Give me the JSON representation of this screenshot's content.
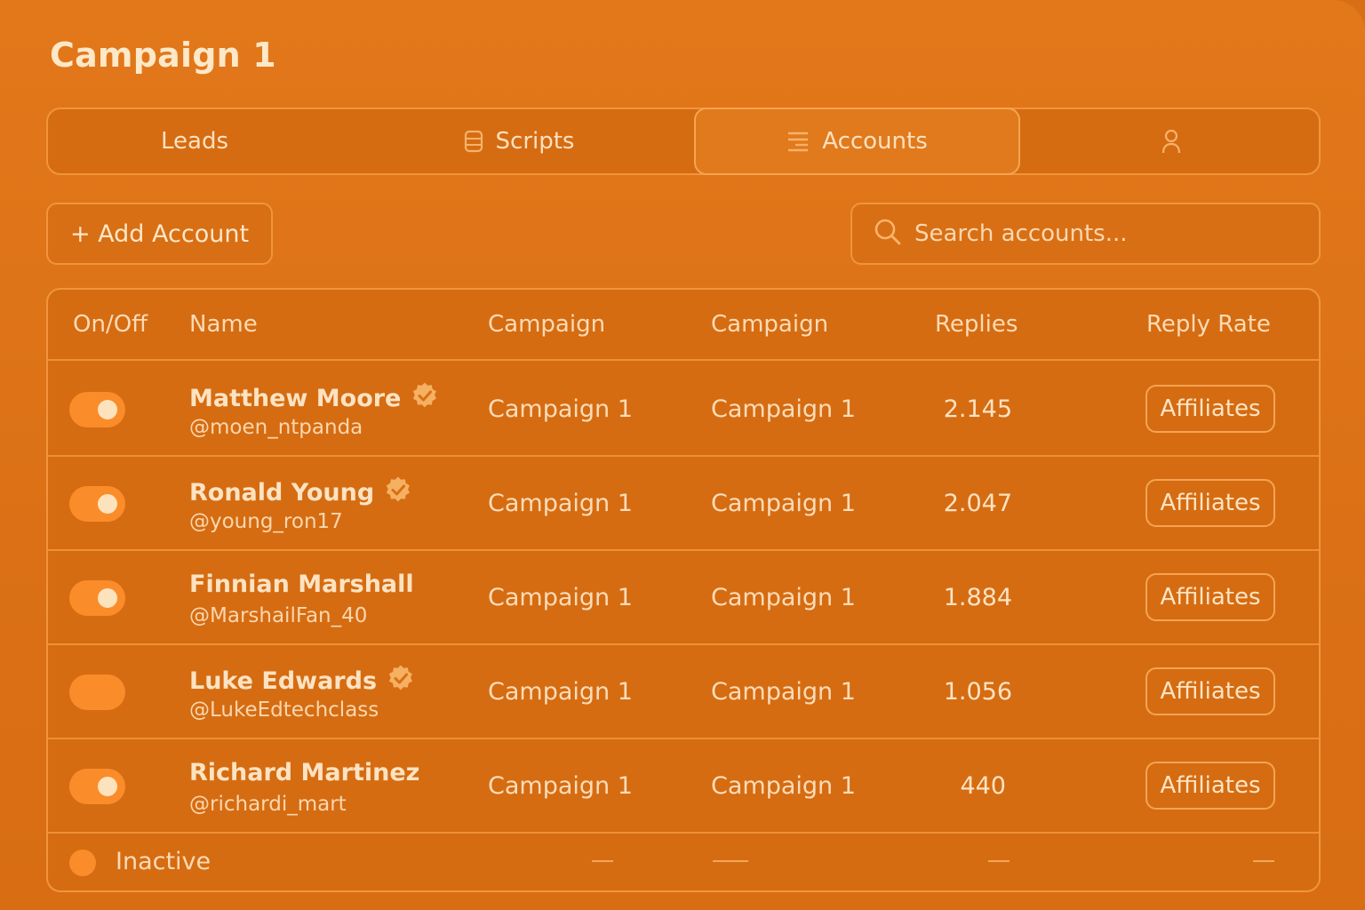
{
  "title": "Campaign 1",
  "tabs": [
    {
      "label": "Leads",
      "icon": ""
    },
    {
      "label": "Scripts",
      "icon": "document-icon"
    },
    {
      "label": "Accounts",
      "icon": "list-icon",
      "active": true
    },
    {
      "label": "",
      "icon": "user-icon"
    }
  ],
  "toolbar": {
    "add_label": "+ Add Account",
    "search_placeholder": "Search accounts..."
  },
  "table": {
    "headers": [
      "On/Off",
      "Name",
      "Campaign",
      "Campaign",
      "Replies",
      "Reply Rate"
    ],
    "rows": [
      {
        "on": true,
        "name": "Matthew Moore",
        "verified": true,
        "handle": "@moen_ntpanda",
        "campaign_a": "Campaign 1",
        "campaign_b": "Campaign 1",
        "replies": "2.145",
        "tag": "Affiliates"
      },
      {
        "on": true,
        "name": "Ronald Young",
        "verified": true,
        "handle": "@young_ron17",
        "campaign_a": "Campaign 1",
        "campaign_b": "Campaign 1",
        "replies": "2.047",
        "tag": "Affiliates"
      },
      {
        "on": true,
        "name": "Finnian Marshall",
        "verified": false,
        "handle": "@MarshailFan_40",
        "campaign_a": "Campaign 1",
        "campaign_b": "Campaign 1",
        "replies": "1.884",
        "tag": "Affiliates"
      },
      {
        "on": false,
        "name": "Luke Edwards",
        "verified": true,
        "handle": "@LukeEdtechclass",
        "campaign_a": "Campaign 1",
        "campaign_b": "Campaign 1",
        "replies": "1.056",
        "tag": "Affiliates"
      },
      {
        "on": true,
        "name": "Richard Martinez",
        "verified": false,
        "handle": "@richardi_mart",
        "campaign_a": "Campaign 1",
        "campaign_b": "Campaign 1",
        "replies": "440",
        "tag": "Affiliates"
      }
    ],
    "footer": {
      "label": "Inactive"
    }
  },
  "colors": {
    "background": "#d86f14",
    "border": "#f0953c",
    "toggle": "#fb8c2a",
    "text": "#fde2c2"
  }
}
